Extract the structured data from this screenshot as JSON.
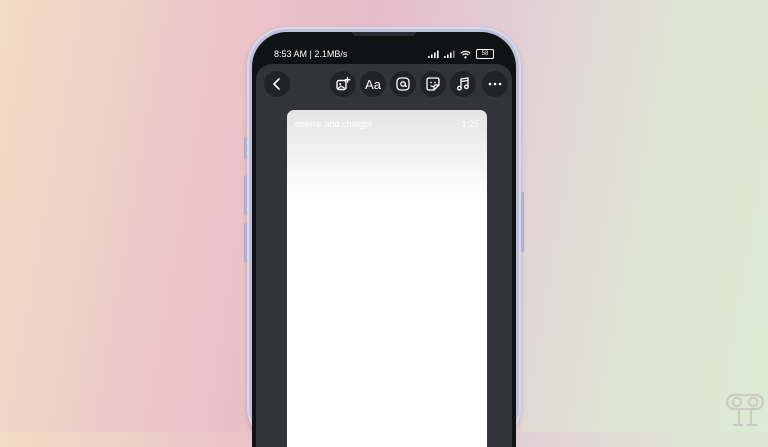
{
  "status_bar": {
    "time_speed": "8:53 AM | 2.1MB/s",
    "battery": "58",
    "icons": [
      "signal-icon",
      "signal-icon",
      "wifi-icon",
      "battery-icon"
    ]
  },
  "toolbar": {
    "buttons": [
      {
        "name": "back-button",
        "icon": "chevron-left-icon"
      },
      {
        "name": "media-overlay-button",
        "icon": "image-plus-icon"
      },
      {
        "name": "text-button",
        "label": "Aa"
      },
      {
        "name": "mention-button",
        "icon": "at-icon"
      },
      {
        "name": "sticker-button",
        "icon": "sticker-icon"
      },
      {
        "name": "music-button",
        "icon": "music-note-icon"
      },
      {
        "name": "more-button",
        "icon": "more-horizontal-icon"
      }
    ]
  },
  "story": {
    "caption": "openai and chatgpt",
    "duration": "1:25"
  },
  "colors": {
    "panel": "#333438",
    "screen": "#111214",
    "card": "#ffffff"
  }
}
